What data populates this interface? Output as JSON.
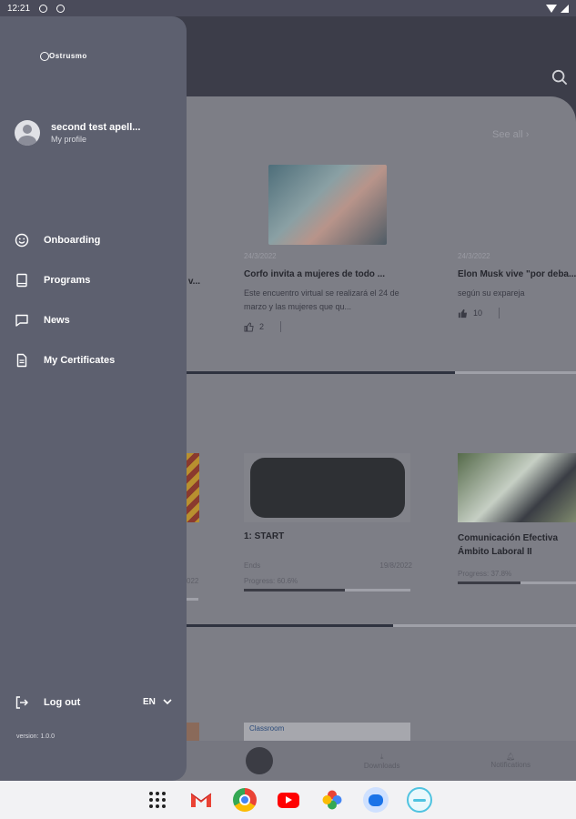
{
  "status_bar": {
    "time": "12:21"
  },
  "drawer": {
    "logo_text": "Ostrusmo",
    "profile": {
      "name": "second test apell...",
      "subtitle": "My profile"
    },
    "menu": [
      {
        "label": "Onboarding",
        "icon": "smile-icon"
      },
      {
        "label": "Programs",
        "icon": "book-icon"
      },
      {
        "label": "News",
        "icon": "chat-icon"
      },
      {
        "label": "My Certificates",
        "icon": "document-icon"
      }
    ],
    "logout_label": "Log out",
    "language": "EN",
    "version": "version: 1.0.0"
  },
  "background": {
    "see_all": "See all",
    "news": [
      {
        "date": "24/3/2022",
        "title": "Corfo invita a mujeres de todo ...",
        "desc": "Este encuentro virtual se realizará el 24 de marzo y las mujeres que qu...",
        "likes": "2"
      },
      {
        "date": "24/3/2022",
        "title": "Elon Musk vive \"por deba...",
        "desc": "según su expareja",
        "likes": "10"
      }
    ],
    "partial_left_title": "v...",
    "programs": [
      {
        "title": "1: START",
        "ends_label": "Ends",
        "ends_date": "19/8/2022",
        "progress_label": "Progress: 60.6%",
        "progress": 0.606
      },
      {
        "title": "Comunicación Efectiva Ámbito Laboral II",
        "progress_label": "Progress: 37.8%",
        "progress": 0.378
      }
    ],
    "partial_left_date": "022",
    "bottom_card_label": "Classroom",
    "bottom_nav": {
      "downloads": "Downloads",
      "notifications": "Notifications"
    }
  },
  "colors": {
    "drawer_bg": "#5d606f",
    "scrim_bg": "#3c3d49",
    "content_bg": "#7d7e86"
  }
}
